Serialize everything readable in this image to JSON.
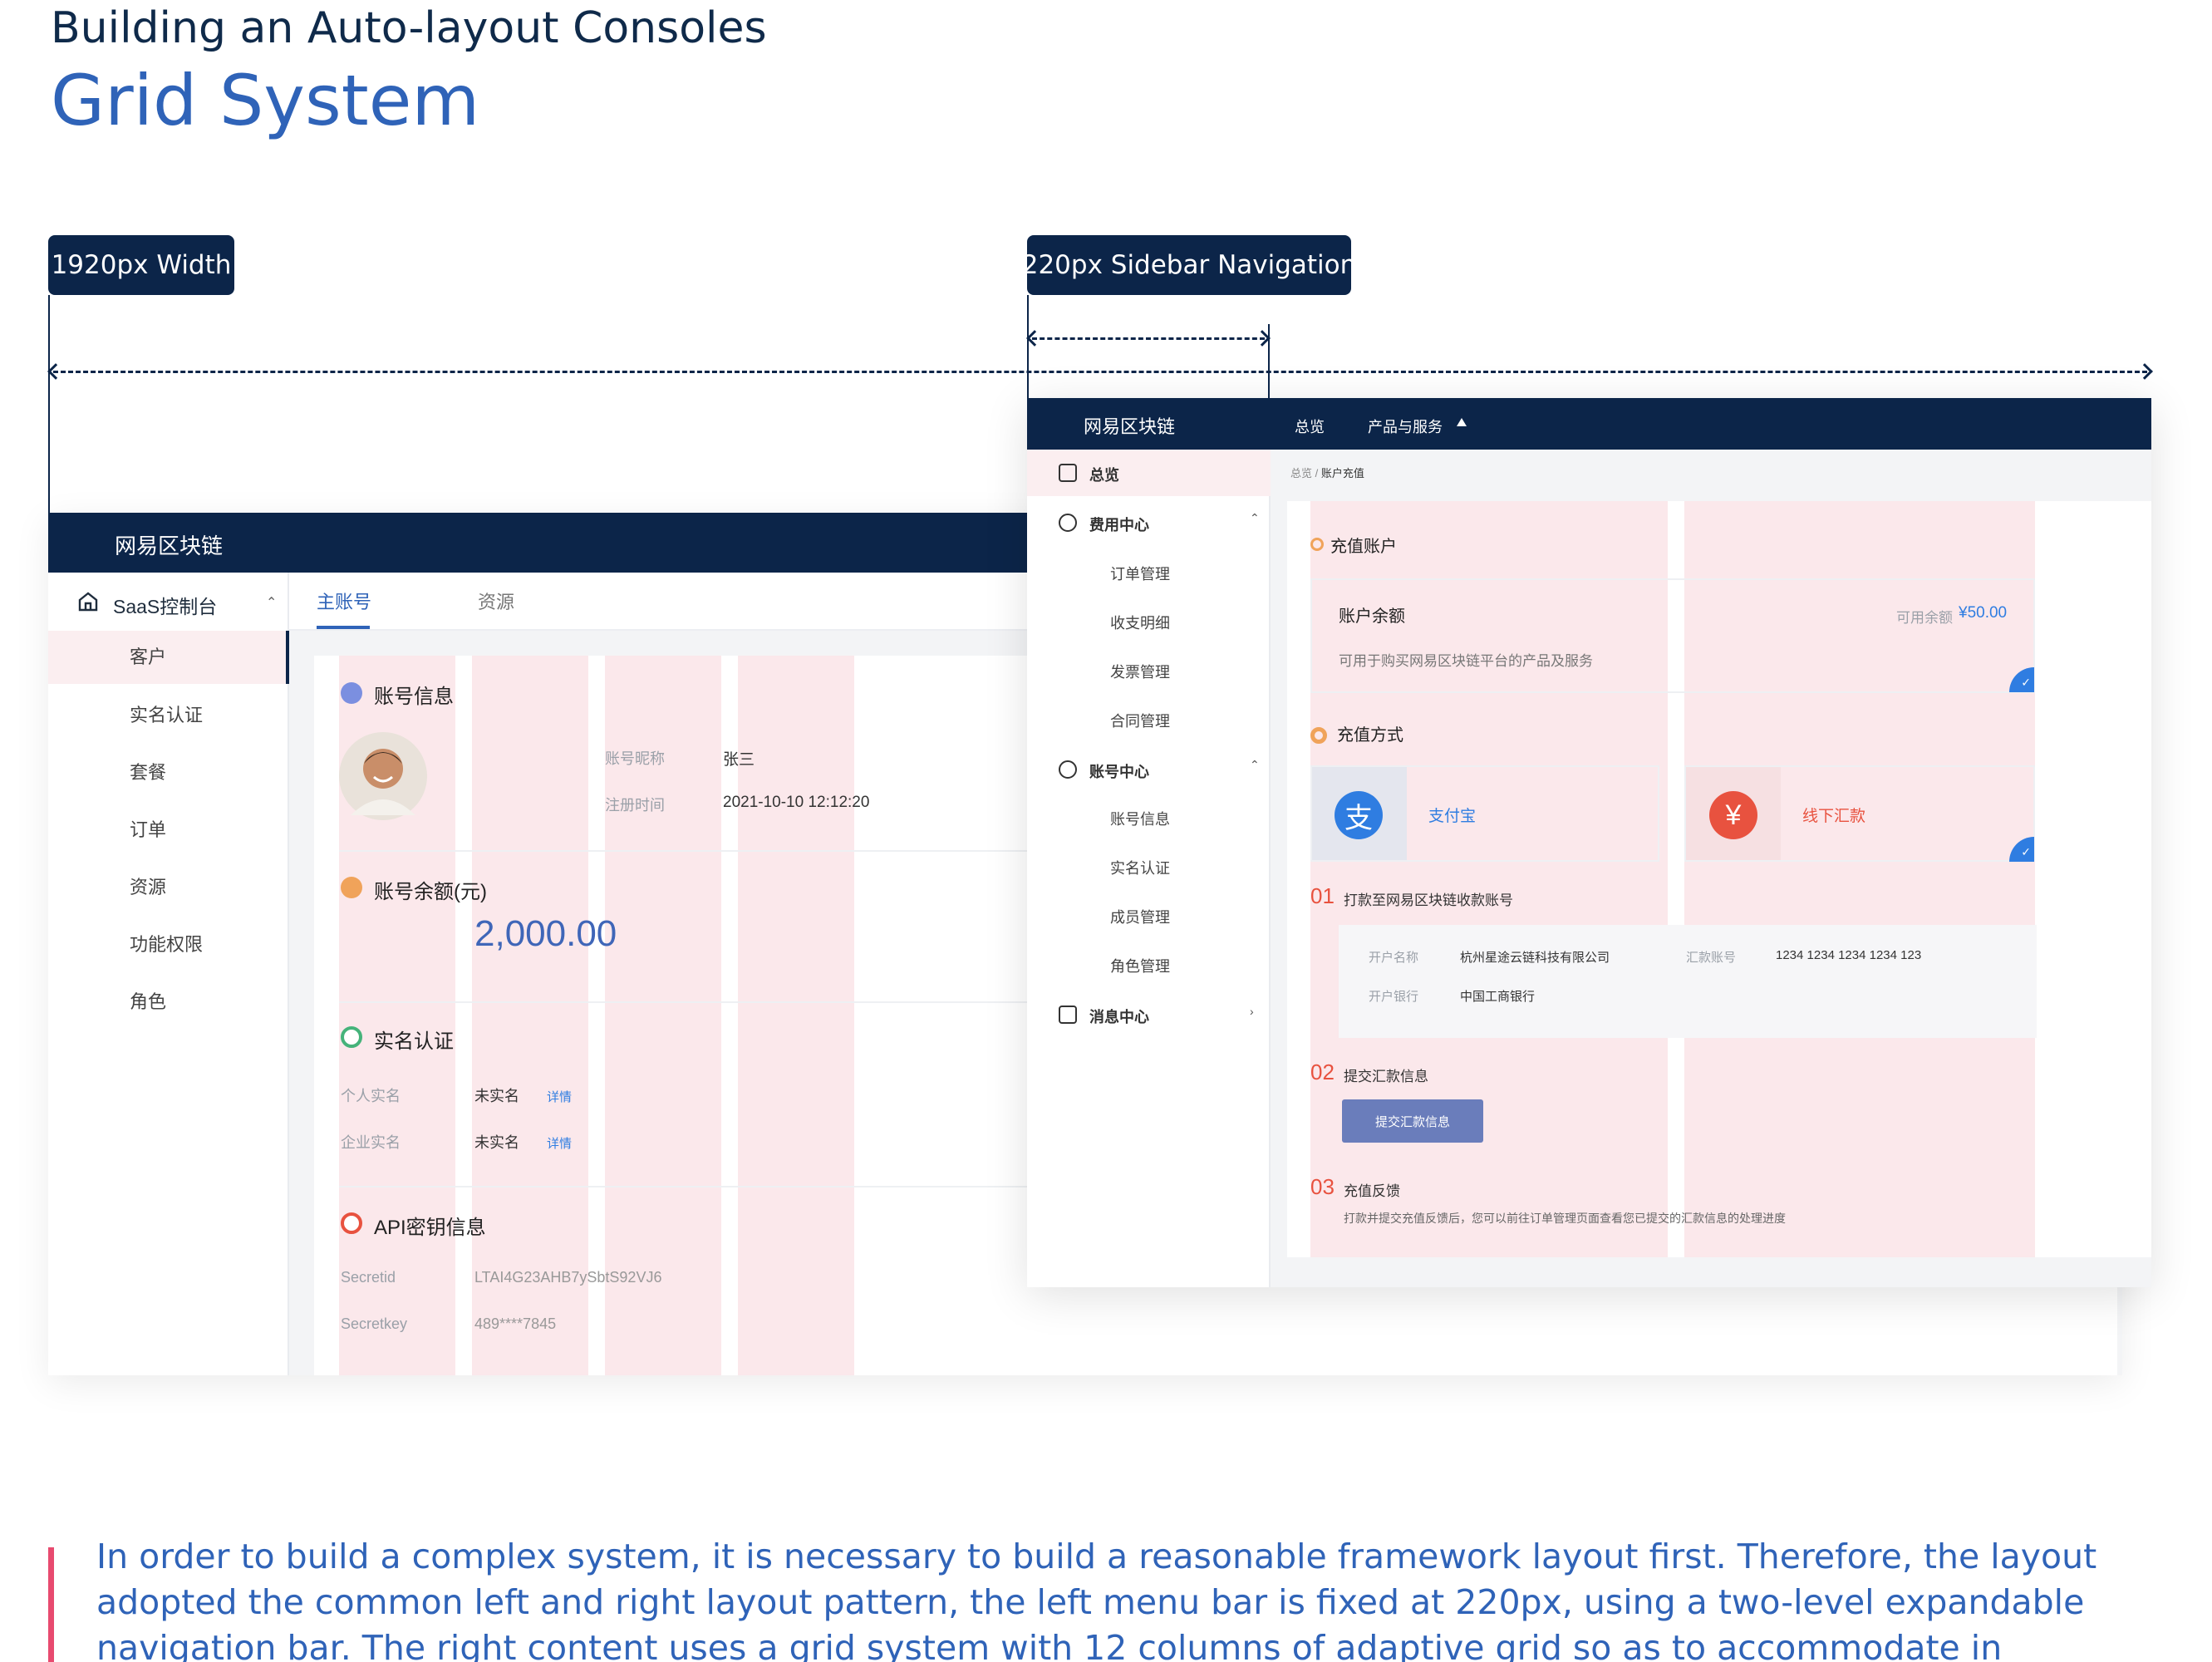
{
  "header": {
    "subtitle": "Building an Auto-layout Consoles",
    "title": "Grid System"
  },
  "annotations": {
    "width_tag": "1920px Width",
    "sidebar_tag": "220px Sidebar Navigation"
  },
  "left_console": {
    "brand": "网易区块链",
    "sidebar": {
      "head_label": "SaaS控制台",
      "items": [
        "客户",
        "实名认证",
        "套餐",
        "订单",
        "资源",
        "功能权限",
        "角色"
      ]
    },
    "tabs": [
      "主账号",
      "资源"
    ],
    "account_info": {
      "title": "账号信息",
      "nickname_label": "账号昵称",
      "nickname": "张三",
      "reg_label": "注册时间",
      "reg_time": "2021-10-10 12:12:20"
    },
    "balance": {
      "title": "账号余额(元)",
      "amount": "2,000.00"
    },
    "verify": {
      "title": "实名认证",
      "personal_label": "个人实名",
      "personal_value": "未实名",
      "personal_link": "详情",
      "company_label": "企业实名",
      "company_value": "未实名",
      "company_link": "详情"
    },
    "api": {
      "title": "API密钥信息",
      "id_label": "Secretid",
      "id_value": "LTAI4G23AHB7ySbtS92VJ6",
      "key_label": "Secretkey",
      "key_value": "489****7845"
    }
  },
  "right_console": {
    "brand": "网易区块链",
    "nav": [
      "总览",
      "产品与服务"
    ],
    "sidebar": {
      "overview": "总览",
      "fee_center": "费用中心",
      "fee_items": [
        "订单管理",
        "收支明细",
        "发票管理",
        "合同管理"
      ],
      "account_center": "账号中心",
      "account_items": [
        "账号信息",
        "实名认证",
        "成员管理",
        "角色管理"
      ],
      "message_center": "消息中心"
    },
    "breadcrumb": {
      "root": "总览",
      "sep": "/",
      "current": "账户充值"
    },
    "recharge": {
      "title": "充值账户",
      "balance_label": "账户余额",
      "available_label": "可用余额",
      "available_value": "¥50.00",
      "balance_desc": "可用于购买网易区块链平台的产品及服务"
    },
    "method": {
      "title": "充值方式",
      "alipay": "支付宝",
      "offline": "线下汇款"
    },
    "steps": {
      "s1_num": "01",
      "s1_text": "打款至网易区块链收款账号",
      "account_name_label": "开户名称",
      "account_name": "杭州星途云链科技有限公司",
      "bank_label": "开户银行",
      "bank": "中国工商银行",
      "remit_label": "汇款账号",
      "remit_no": "1234 1234 1234 1234 123",
      "s2_num": "02",
      "s2_text": "提交汇款信息",
      "submit_btn": "提交汇款信息",
      "s3_num": "03",
      "s3_text": "充值反馈",
      "s3_desc": "打款并提交充值反馈后，您可以前往订单管理页面查看您已提交的汇款信息的处理进度"
    }
  },
  "description": "In order to build a complex system, it is necessary to build a reasonable framework layout first. Therefore, the layout adopted the common left and right layout pattern, the left menu bar is fixed at 220px, using a two-level expandable navigation bar. The right content uses a grid system with 12 columns of adaptive grid so as to accommodate in different PC sizes",
  "colors": {
    "navy": "#0c2549",
    "brand_blue": "#2f63b8",
    "grid_highlight": "#f8d6da",
    "accent_red": "#e8523f",
    "alipay_blue": "#2f7de1"
  }
}
